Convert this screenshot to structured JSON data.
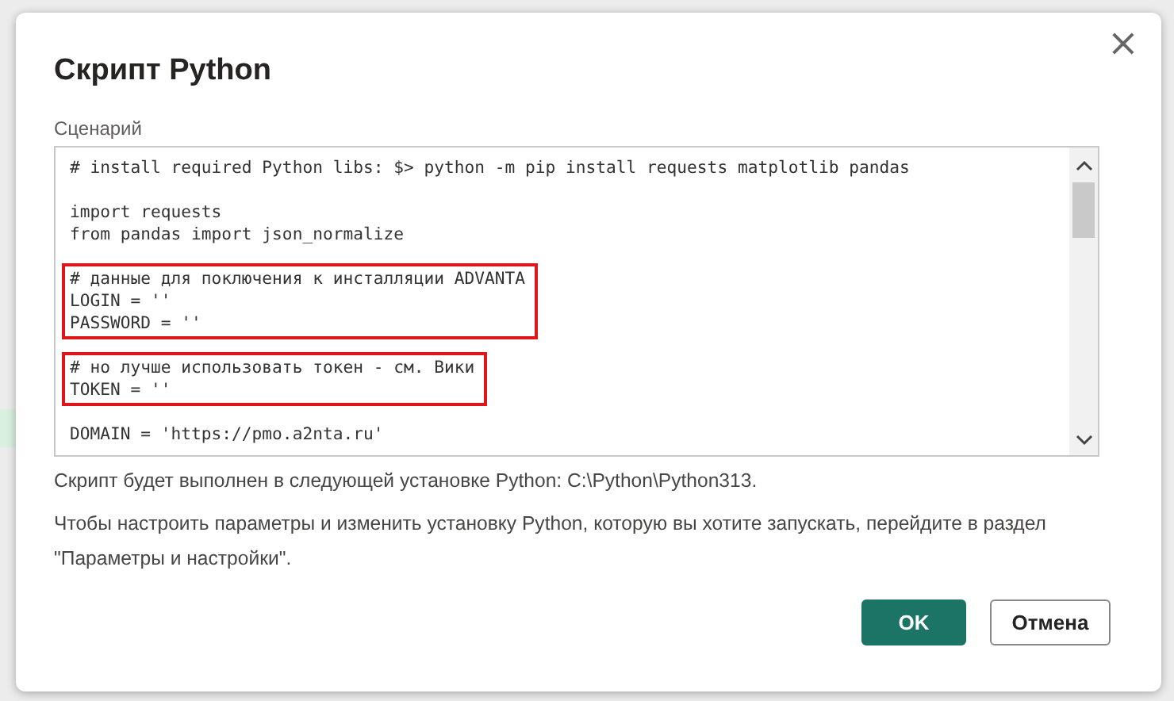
{
  "dialog": {
    "title": "Скрипт Python",
    "close": "×",
    "script_label": "Сценарий",
    "code_blocks": [
      {
        "highlighted": false,
        "lines": [
          "# install required Python libs: $> python -m pip install requests matplotlib pandas"
        ]
      },
      {
        "highlighted": false,
        "lines": [
          "import requests",
          "from pandas import json_normalize"
        ]
      },
      {
        "highlighted": true,
        "lines": [
          "# данные для поключения к инсталляции ADVANTA",
          "LOGIN = ''",
          "PASSWORD = ''"
        ]
      },
      {
        "highlighted": true,
        "lines": [
          "# но лучше использовать токен - см. Вики",
          "TOKEN = ''"
        ]
      },
      {
        "highlighted": false,
        "lines": [
          "DOMAIN = 'https://pmo.a2nta.ru'"
        ]
      }
    ],
    "info": [
      "Скрипт будет выполнен в следующей установке Python: C:\\Python\\Python313.",
      "Чтобы настроить параметры и изменить установку Python, которую вы хотите запускать, перейдите в раздел \"Параметры и настройки\"."
    ],
    "buttons": [
      {
        "label": "OK",
        "primary": true
      },
      {
        "label": "Отмена",
        "primary": false
      }
    ]
  }
}
